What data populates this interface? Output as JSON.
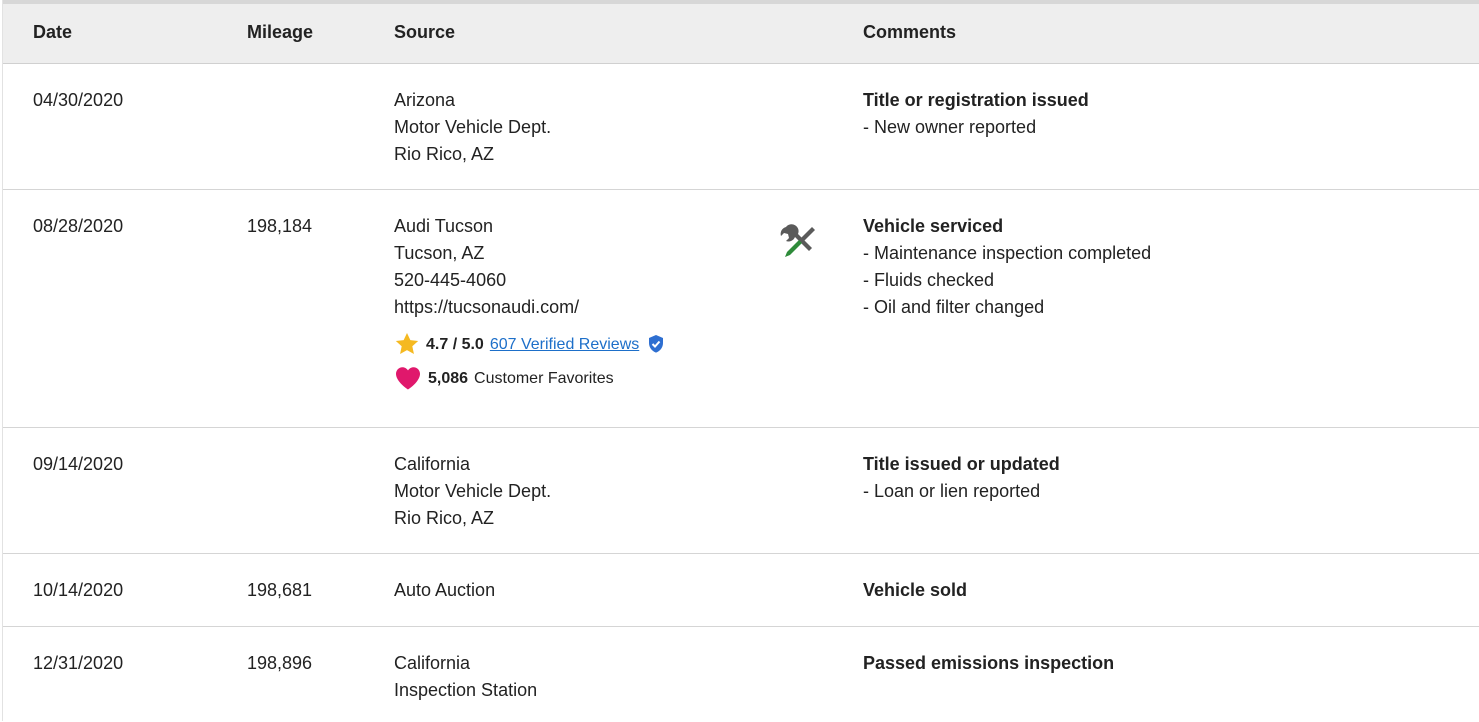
{
  "header": {
    "date": "Date",
    "mileage": "Mileage",
    "source": "Source",
    "comments": "Comments"
  },
  "rows": [
    {
      "date": "04/30/2020",
      "mileage": "",
      "source": [
        "Arizona",
        "Motor Vehicle Dept.",
        "Rio Rico, AZ"
      ],
      "comment_title": "Title or registration issued",
      "comment_items": [
        "- New owner reported"
      ]
    },
    {
      "date": "08/28/2020",
      "mileage": "198,184",
      "source": [
        "Audi Tucson",
        "Tucson, AZ",
        "520-445-4060",
        "https://tucsonaudi.com/"
      ],
      "rating": "4.7 / 5.0",
      "reviews_link": "607 Verified Reviews",
      "favorites_count": "5,086",
      "favorites_label": "Customer Favorites",
      "comment_title": "Vehicle serviced",
      "comment_items": [
        "- Maintenance inspection completed",
        "- Fluids checked",
        "- Oil and filter changed"
      ]
    },
    {
      "date": "09/14/2020",
      "mileage": "",
      "source": [
        "California",
        "Motor Vehicle Dept.",
        "Rio Rico, AZ"
      ],
      "comment_title": "Title issued or updated",
      "comment_items": [
        "- Loan or lien reported"
      ]
    },
    {
      "date": "10/14/2020",
      "mileage": "198,681",
      "source": [
        "Auto Auction"
      ],
      "comment_title": "Vehicle sold",
      "comment_items": []
    },
    {
      "date": "12/31/2020",
      "mileage": "198,896",
      "source": [
        "California",
        "Inspection Station"
      ],
      "comment_title": "Passed emissions inspection",
      "comment_items": []
    }
  ],
  "icons": {
    "service": "wrench-screwdriver-icon",
    "rating": "star-icon",
    "verified": "verified-shield-icon",
    "favorites": "heart-icon"
  },
  "colors": {
    "link": "#1d6fc9",
    "star": "#f5b921",
    "heart": "#e0186c",
    "verified": "#2e6fd1",
    "tool_green": "#2e8b3a",
    "header_bg": "#eeeeee"
  }
}
